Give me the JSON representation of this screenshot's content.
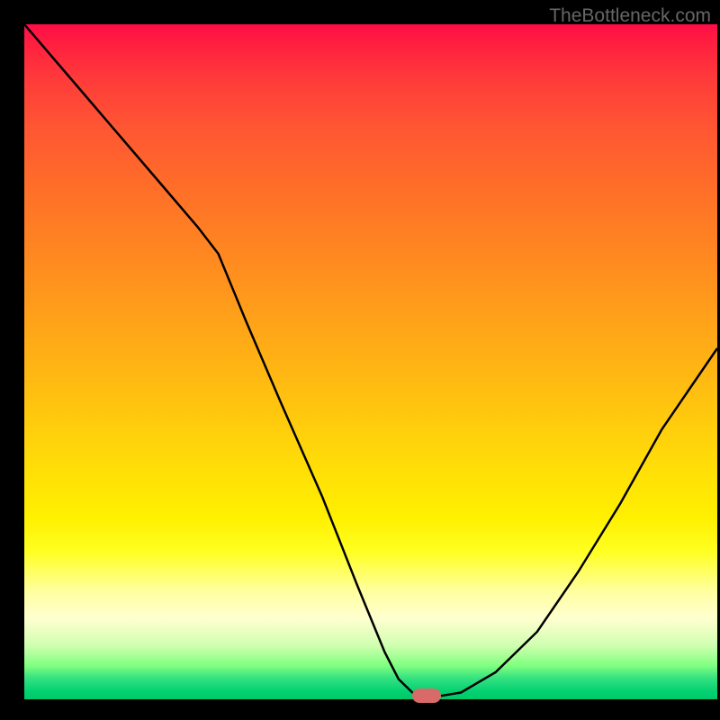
{
  "watermark": "TheBottleneck.com",
  "chart_data": {
    "type": "line",
    "x": [
      0,
      5,
      10,
      15,
      20,
      25,
      28,
      32,
      37,
      43,
      48,
      52,
      54,
      56,
      58,
      60,
      63,
      68,
      74,
      80,
      86,
      92,
      100
    ],
    "values": [
      100,
      94,
      88,
      82,
      76,
      70,
      66,
      56,
      44,
      30,
      17,
      7,
      3,
      1,
      0.5,
      0.5,
      1,
      4,
      10,
      19,
      29,
      40,
      52
    ],
    "title": "",
    "xlabel": "",
    "ylabel": "",
    "ylim": [
      0,
      100
    ],
    "xlim": [
      0,
      100
    ],
    "marker": {
      "x": 58,
      "y": 0.5
    },
    "gradient_zones": [
      {
        "color": "#ff0d47",
        "stop": 0
      },
      {
        "color": "#ffdc08",
        "stop": 65
      },
      {
        "color": "#00c868",
        "stop": 100
      }
    ]
  }
}
